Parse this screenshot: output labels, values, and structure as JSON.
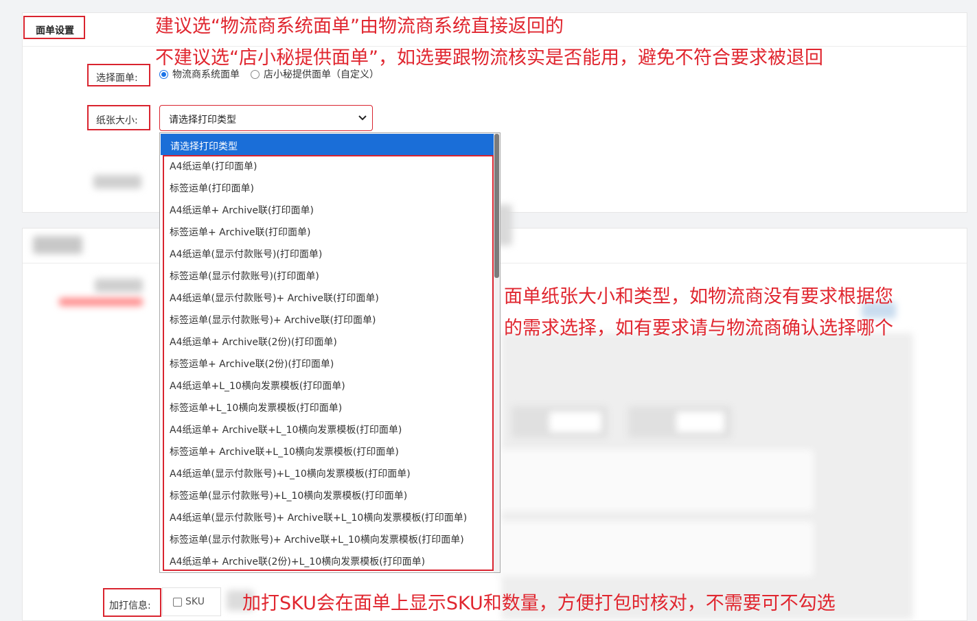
{
  "section_title": "面单设置",
  "waybill": {
    "label": "选择面单:",
    "options": [
      "物流商系统面单",
      "店小秘提供面单（自定义）"
    ],
    "selected_index": 0
  },
  "paper_size": {
    "label": "纸张大小:",
    "selected": "请选择打印类型",
    "dropdown_items": [
      "请选择打印类型",
      "A4纸运单(打印面单)",
      "标签运单(打印面单)",
      "A4纸运单+ Archive联(打印面单)",
      "标签运单+ Archive联(打印面单)",
      "A4纸运单(显示付款账号)(打印面单)",
      "标签运单(显示付款账号)(打印面单)",
      "A4纸运单(显示付款账号)+ Archive联(打印面单)",
      "标签运单(显示付款账号)+ Archive联(打印面单)",
      "A4纸运单+ Archive联(2份)(打印面单)",
      "标签运单+ Archive联(2份)(打印面单)",
      "A4纸运单+L_10横向发票模板(打印面单)",
      "标签运单+L_10横向发票模板(打印面单)",
      "A4纸运单+ Archive联+L_10横向发票模板(打印面单)",
      "标签运单+ Archive联+L_10横向发票模板(打印面单)",
      "A4纸运单(显示付款账号)+L_10横向发票模板(打印面单)",
      "标签运单(显示付款账号)+L_10横向发票模板(打印面单)",
      "A4纸运单(显示付款账号)+ Archive联+L_10横向发票模板(打印面单)",
      "标签运单(显示付款账号)+ Archive联+L_10横向发票模板(打印面单)",
      "A4纸运单+ Archive联(2份)+L_10横向发票模板(打印面单)"
    ]
  },
  "extra_print": {
    "label": "加打信息:",
    "checkbox_label": "SKU",
    "checked": false
  },
  "annotations": {
    "line1": "建议选“物流商系统面单”由物流商系统直接返回的",
    "line2": "不建议选“店小秘提供面单”，如选要跟物流核实是否能用，避免不符合要求被退回",
    "line3": "面单纸张大小和类型，如物流商没有要求根据您",
    "line4": "的需求选择，如有要求请与物流商确认选择哪个",
    "line5": "加打SKU会在面单上显示SKU和数量，方便打包时核对，不需要可不勾选"
  },
  "colors": {
    "annotation_red": "#e0262f",
    "highlight_blue": "#1a6ed8",
    "radio_blue": "#1a73e8"
  }
}
